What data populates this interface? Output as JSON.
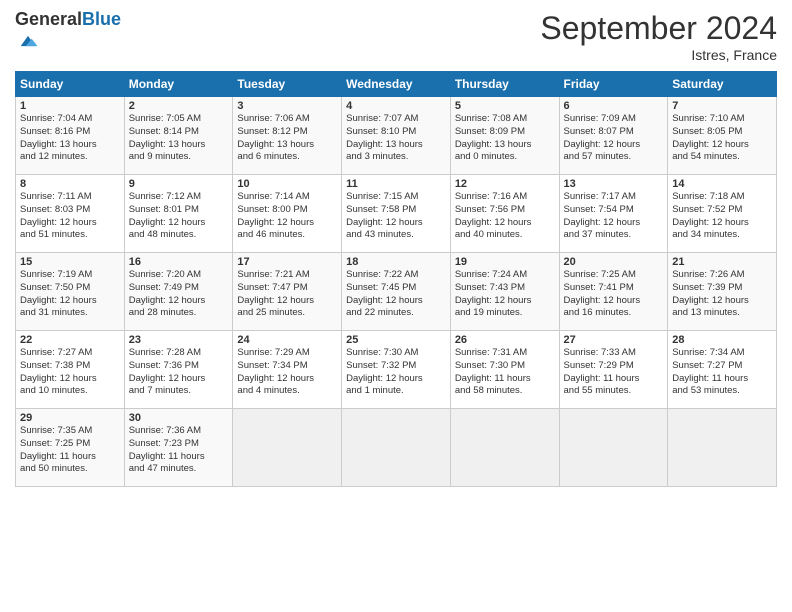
{
  "header": {
    "logo_general": "General",
    "logo_blue": "Blue",
    "title": "September 2024",
    "subtitle": "Istres, France"
  },
  "days_of_week": [
    "Sunday",
    "Monday",
    "Tuesday",
    "Wednesday",
    "Thursday",
    "Friday",
    "Saturday"
  ],
  "weeks": [
    [
      {
        "day": "1",
        "info": "Sunrise: 7:04 AM\nSunset: 8:16 PM\nDaylight: 13 hours\nand 12 minutes."
      },
      {
        "day": "2",
        "info": "Sunrise: 7:05 AM\nSunset: 8:14 PM\nDaylight: 13 hours\nand 9 minutes."
      },
      {
        "day": "3",
        "info": "Sunrise: 7:06 AM\nSunset: 8:12 PM\nDaylight: 13 hours\nand 6 minutes."
      },
      {
        "day": "4",
        "info": "Sunrise: 7:07 AM\nSunset: 8:10 PM\nDaylight: 13 hours\nand 3 minutes."
      },
      {
        "day": "5",
        "info": "Sunrise: 7:08 AM\nSunset: 8:09 PM\nDaylight: 13 hours\nand 0 minutes."
      },
      {
        "day": "6",
        "info": "Sunrise: 7:09 AM\nSunset: 8:07 PM\nDaylight: 12 hours\nand 57 minutes."
      },
      {
        "day": "7",
        "info": "Sunrise: 7:10 AM\nSunset: 8:05 PM\nDaylight: 12 hours\nand 54 minutes."
      }
    ],
    [
      {
        "day": "8",
        "info": "Sunrise: 7:11 AM\nSunset: 8:03 PM\nDaylight: 12 hours\nand 51 minutes."
      },
      {
        "day": "9",
        "info": "Sunrise: 7:12 AM\nSunset: 8:01 PM\nDaylight: 12 hours\nand 48 minutes."
      },
      {
        "day": "10",
        "info": "Sunrise: 7:14 AM\nSunset: 8:00 PM\nDaylight: 12 hours\nand 46 minutes."
      },
      {
        "day": "11",
        "info": "Sunrise: 7:15 AM\nSunset: 7:58 PM\nDaylight: 12 hours\nand 43 minutes."
      },
      {
        "day": "12",
        "info": "Sunrise: 7:16 AM\nSunset: 7:56 PM\nDaylight: 12 hours\nand 40 minutes."
      },
      {
        "day": "13",
        "info": "Sunrise: 7:17 AM\nSunset: 7:54 PM\nDaylight: 12 hours\nand 37 minutes."
      },
      {
        "day": "14",
        "info": "Sunrise: 7:18 AM\nSunset: 7:52 PM\nDaylight: 12 hours\nand 34 minutes."
      }
    ],
    [
      {
        "day": "15",
        "info": "Sunrise: 7:19 AM\nSunset: 7:50 PM\nDaylight: 12 hours\nand 31 minutes."
      },
      {
        "day": "16",
        "info": "Sunrise: 7:20 AM\nSunset: 7:49 PM\nDaylight: 12 hours\nand 28 minutes."
      },
      {
        "day": "17",
        "info": "Sunrise: 7:21 AM\nSunset: 7:47 PM\nDaylight: 12 hours\nand 25 minutes."
      },
      {
        "day": "18",
        "info": "Sunrise: 7:22 AM\nSunset: 7:45 PM\nDaylight: 12 hours\nand 22 minutes."
      },
      {
        "day": "19",
        "info": "Sunrise: 7:24 AM\nSunset: 7:43 PM\nDaylight: 12 hours\nand 19 minutes."
      },
      {
        "day": "20",
        "info": "Sunrise: 7:25 AM\nSunset: 7:41 PM\nDaylight: 12 hours\nand 16 minutes."
      },
      {
        "day": "21",
        "info": "Sunrise: 7:26 AM\nSunset: 7:39 PM\nDaylight: 12 hours\nand 13 minutes."
      }
    ],
    [
      {
        "day": "22",
        "info": "Sunrise: 7:27 AM\nSunset: 7:38 PM\nDaylight: 12 hours\nand 10 minutes."
      },
      {
        "day": "23",
        "info": "Sunrise: 7:28 AM\nSunset: 7:36 PM\nDaylight: 12 hours\nand 7 minutes."
      },
      {
        "day": "24",
        "info": "Sunrise: 7:29 AM\nSunset: 7:34 PM\nDaylight: 12 hours\nand 4 minutes."
      },
      {
        "day": "25",
        "info": "Sunrise: 7:30 AM\nSunset: 7:32 PM\nDaylight: 12 hours\nand 1 minute."
      },
      {
        "day": "26",
        "info": "Sunrise: 7:31 AM\nSunset: 7:30 PM\nDaylight: 11 hours\nand 58 minutes."
      },
      {
        "day": "27",
        "info": "Sunrise: 7:33 AM\nSunset: 7:29 PM\nDaylight: 11 hours\nand 55 minutes."
      },
      {
        "day": "28",
        "info": "Sunrise: 7:34 AM\nSunset: 7:27 PM\nDaylight: 11 hours\nand 53 minutes."
      }
    ],
    [
      {
        "day": "29",
        "info": "Sunrise: 7:35 AM\nSunset: 7:25 PM\nDaylight: 11 hours\nand 50 minutes."
      },
      {
        "day": "30",
        "info": "Sunrise: 7:36 AM\nSunset: 7:23 PM\nDaylight: 11 hours\nand 47 minutes."
      },
      {
        "day": "",
        "info": ""
      },
      {
        "day": "",
        "info": ""
      },
      {
        "day": "",
        "info": ""
      },
      {
        "day": "",
        "info": ""
      },
      {
        "day": "",
        "info": ""
      }
    ]
  ]
}
